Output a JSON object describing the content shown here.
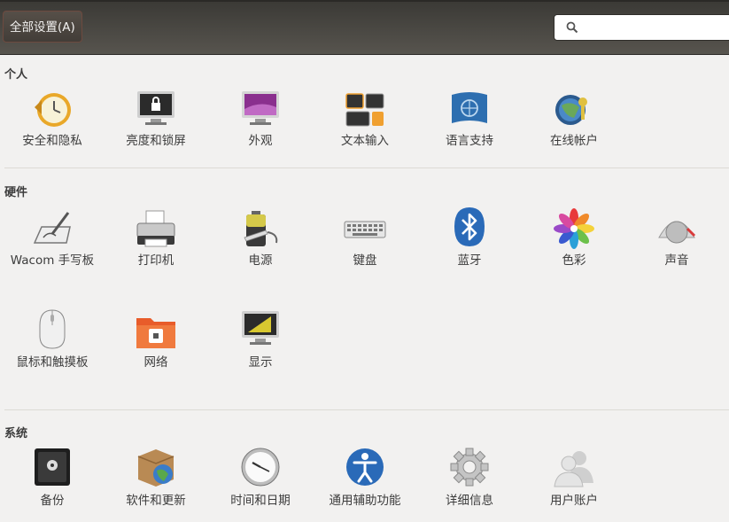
{
  "toolbar": {
    "all_settings_label": "全部设置(A)",
    "search_placeholder": ""
  },
  "sections": {
    "personal": {
      "title": "个人",
      "items": [
        "安全和隐私",
        "亮度和锁屏",
        "外观",
        "文本输入",
        "语言支持",
        "在线帐户"
      ]
    },
    "hardware": {
      "title": "硬件",
      "items": [
        "Wacom 手写板",
        "打印机",
        "电源",
        "键盘",
        "蓝牙",
        "色彩",
        "声音",
        "鼠标和触摸板",
        "网络",
        "显示"
      ]
    },
    "system": {
      "title": "系统",
      "items": [
        "备份",
        "软件和更新",
        "时间和日期",
        "通用辅助功能",
        "详细信息",
        "用户账户"
      ]
    }
  },
  "icons": [
    "security-privacy-icon",
    "brightness-lock-icon",
    "appearance-icon",
    "text-entry-icon",
    "language-support-icon",
    "online-accounts-icon",
    "wacom-tablet-icon",
    "printer-icon",
    "power-icon",
    "keyboard-icon",
    "bluetooth-icon",
    "color-icon",
    "sound-icon",
    "mouse-touchpad-icon",
    "network-icon",
    "display-icon",
    "backup-icon",
    "software-updates-icon",
    "time-date-icon",
    "universal-access-icon",
    "details-icon",
    "user-accounts-icon"
  ],
  "colors": {
    "toolbar": "#4a4843",
    "button_border": "#6d4a3f",
    "background": "#f2f1f0",
    "accent_orange": "#f0a030"
  }
}
